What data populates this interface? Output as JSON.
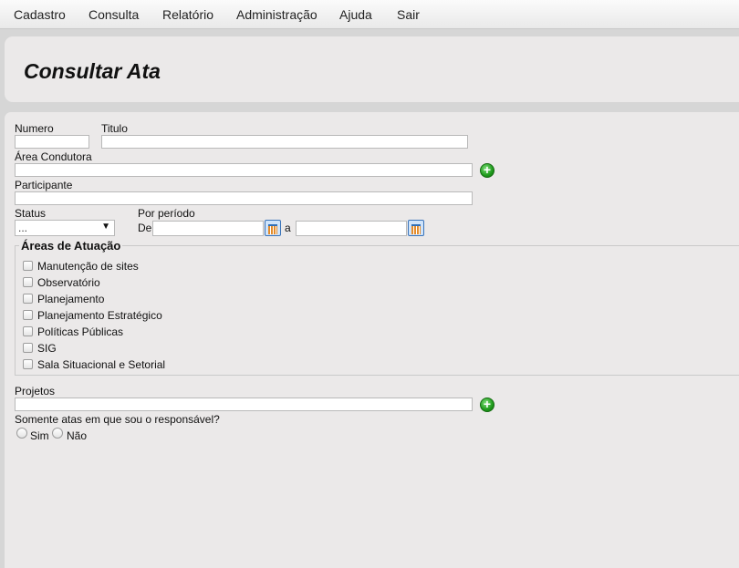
{
  "menu": [
    "Cadastro",
    "Consulta",
    "Relatório",
    "Administração",
    "Ajuda",
    "Sair"
  ],
  "page": {
    "title": "Consultar Ata"
  },
  "form": {
    "numero_label": "Numero",
    "numero_value": "",
    "titulo_label": "Titulo",
    "titulo_value": "",
    "area_condutora_label": "Área Condutora",
    "area_condutora_value": "",
    "participante_label": "Participante",
    "participante_value": "",
    "status_label": "Status",
    "status_selected": "...",
    "periodo_label": "Por período",
    "de_label": "De",
    "de_value": "",
    "a_label": "a",
    "a_value": "",
    "areas_legend": "Áreas de Atuação",
    "areas": [
      {
        "label": "Manutenção de sites",
        "checked": false
      },
      {
        "label": "Observatório",
        "checked": false
      },
      {
        "label": "Planejamento",
        "checked": false
      },
      {
        "label": "Planejamento Estratégico",
        "checked": false
      },
      {
        "label": "Políticas Públicas",
        "checked": false
      },
      {
        "label": "SIG",
        "checked": false
      },
      {
        "label": "Sala Situacional e Setorial",
        "checked": false
      }
    ],
    "projetos_label": "Projetos",
    "projetos_value": "",
    "responsavel_label": "Somente atas em que sou o responsável?",
    "sim_label": "Sim",
    "nao_label": "Não"
  },
  "colors": {
    "add_green": "#1f9a1c",
    "panel_bg": "#ebe9e9",
    "page_bg": "#d6d6d6"
  },
  "icons": {
    "add": "plus-circle-icon",
    "calendar": "calendar-icon",
    "dropdown": "chevron-down-icon"
  }
}
